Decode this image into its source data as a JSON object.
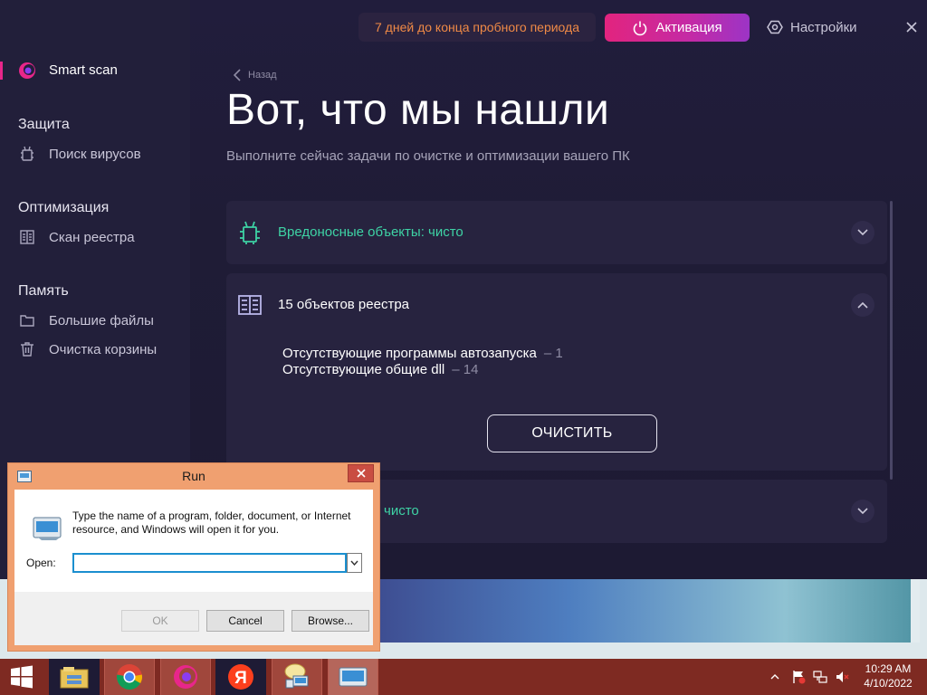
{
  "app": {
    "sidebar": {
      "smart_scan": "Smart scan",
      "sections": [
        {
          "title": "Защита",
          "items": [
            {
              "label": "Поиск вирусов",
              "icon": "bug-icon"
            }
          ]
        },
        {
          "title": "Оптимизация",
          "items": [
            {
              "label": "Скан реестра",
              "icon": "registry-icon"
            }
          ]
        },
        {
          "title": "Память",
          "items": [
            {
              "label": "Большие файлы",
              "icon": "folder-icon"
            },
            {
              "label": "Очистка корзины",
              "icon": "trash-icon"
            }
          ]
        }
      ]
    },
    "header": {
      "trial_text": "7 дней до конца пробного периода",
      "activate_label": "Активация",
      "settings_label": "Настройки"
    },
    "main": {
      "back_label": "Назад",
      "title": "Вот, что мы нашли",
      "subtitle": "Выполните сейчас задачи по очистке и оптимизации вашего ПК",
      "cards": [
        {
          "title": "Вредоносные объекты: чисто",
          "status": "clean",
          "expanded": false
        },
        {
          "title": "15 объектов реестра",
          "expanded": true,
          "details": [
            {
              "label": "Отсутствующие программы автозапуска",
              "count": "– 1"
            },
            {
              "label": "Отсутствующие общие dll",
              "count": "– 14"
            }
          ],
          "clean_button": "ОЧИСТИТЬ"
        },
        {
          "title_visible": "чисто",
          "status": "clean",
          "expanded": false
        }
      ]
    },
    "colors": {
      "accent_pink": "#e2247e",
      "accent_green": "#3ed3a5",
      "trial_orange": "#f08a46",
      "background": "#1e1b35"
    }
  },
  "run_dialog": {
    "title": "Run",
    "description": "Type the name of a program, folder, document, or Internet resource, and Windows will open it for you.",
    "open_label": "Open:",
    "open_value": "",
    "ok": "OK",
    "cancel": "Cancel",
    "browse": "Browse..."
  },
  "taskbar": {
    "apps": [
      "file-explorer-icon",
      "chrome-icon",
      "opera-icon",
      "yandex-icon",
      "network-setup-icon",
      "run-icon"
    ],
    "clock_time": "10:29 AM",
    "clock_date": "4/10/2022"
  }
}
